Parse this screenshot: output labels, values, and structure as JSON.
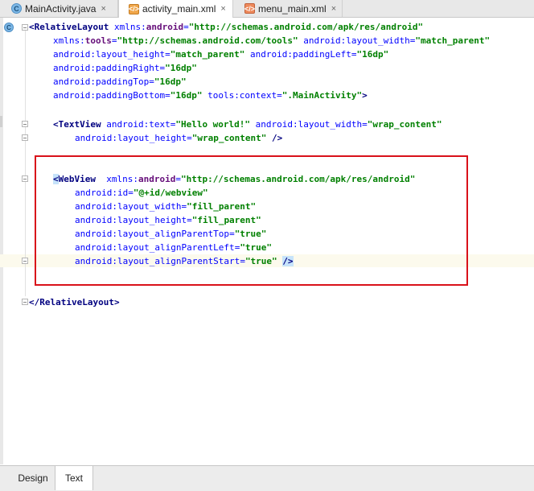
{
  "tabs": [
    {
      "label": "MainActivity.java",
      "icon": "class-icon",
      "close": "×"
    },
    {
      "label": "activity_main.xml",
      "icon": "xml-layout-icon",
      "close": "×"
    },
    {
      "label": "menu_main.xml",
      "icon": "xml-menu-icon",
      "close": "×"
    }
  ],
  "code": {
    "l1_open": "<RelativeLayout",
    "l1_ns": " xmlns:",
    "l1_android": "android",
    "l1_eq": "=",
    "l1_val": "\"http://schemas.android.com/apk/res/android\"",
    "l2_ns": "xmlns:",
    "l2_tools": "tools",
    "l2_eq": "=",
    "l2_val": "\"http://schemas.android.com/tools\"",
    "l2_attr2": " android:layout_width",
    "l2_eq2": "=",
    "l2_val2": "\"match_parent\"",
    "l3_attr": "android:layout_height",
    "l3_eq": "=",
    "l3_val": "\"match_parent\"",
    "l3_attr2": " android:paddingLeft",
    "l3_eq2": "=",
    "l3_val2": "\"16dp\"",
    "l4_attr": "android:paddingRight",
    "l4_eq": "=",
    "l4_val": "\"16dp\"",
    "l5_attr": "android:paddingTop",
    "l5_eq": "=",
    "l5_val": "\"16dp\"",
    "l6_attr": "android:paddingBottom",
    "l6_eq": "=",
    "l6_val": "\"16dp\"",
    "l6_attr2": " tools:context",
    "l6_eq2": "=",
    "l6_val2": "\".MainActivity\"",
    "l6_end": ">",
    "l8_open": "<TextView",
    "l8_attr": " android:text",
    "l8_eq": "=",
    "l8_val": "\"Hello world!\"",
    "l8_attr2": " android:layout_width",
    "l8_eq2": "=",
    "l8_val2": "\"wrap_content\"",
    "l9_attr": "android:layout_height",
    "l9_eq": "=",
    "l9_val": "\"wrap_content\"",
    "l9_end": " />",
    "l12_lt": "<",
    "l12_name": "WebView",
    "l12_ns": "  xmlns:",
    "l12_android": "android",
    "l12_eq": "=",
    "l12_val": "\"http://schemas.android.com/apk/res/android\"",
    "l13_attr": "android:id",
    "l13_eq": "=",
    "l13_val": "\"@+id/webview\"",
    "l14_attr": "android:layout_width",
    "l14_eq": "=",
    "l14_val": "\"fill_parent\"",
    "l15_attr": "android:layout_height",
    "l15_eq": "=",
    "l15_val": "\"fill_parent\"",
    "l16_attr": "android:layout_alignParentTop",
    "l16_eq": "=",
    "l16_val": "\"true\"",
    "l17_attr": "android:layout_alignParentLeft",
    "l17_eq": "=",
    "l17_val": "\"true\"",
    "l18_attr": "android:layout_alignParentStart",
    "l18_eq": "=",
    "l18_val": "\"true\"",
    "l18_end": "/>",
    "l21_close": "</RelativeLayout>"
  },
  "bottom_tabs": [
    {
      "label": "Design"
    },
    {
      "label": "Text"
    }
  ],
  "colors": {
    "tag": "#000080",
    "attribute": "#0000ff",
    "value": "#008000",
    "namespace": "#660e7a",
    "highlight_box": "#d9111a"
  }
}
